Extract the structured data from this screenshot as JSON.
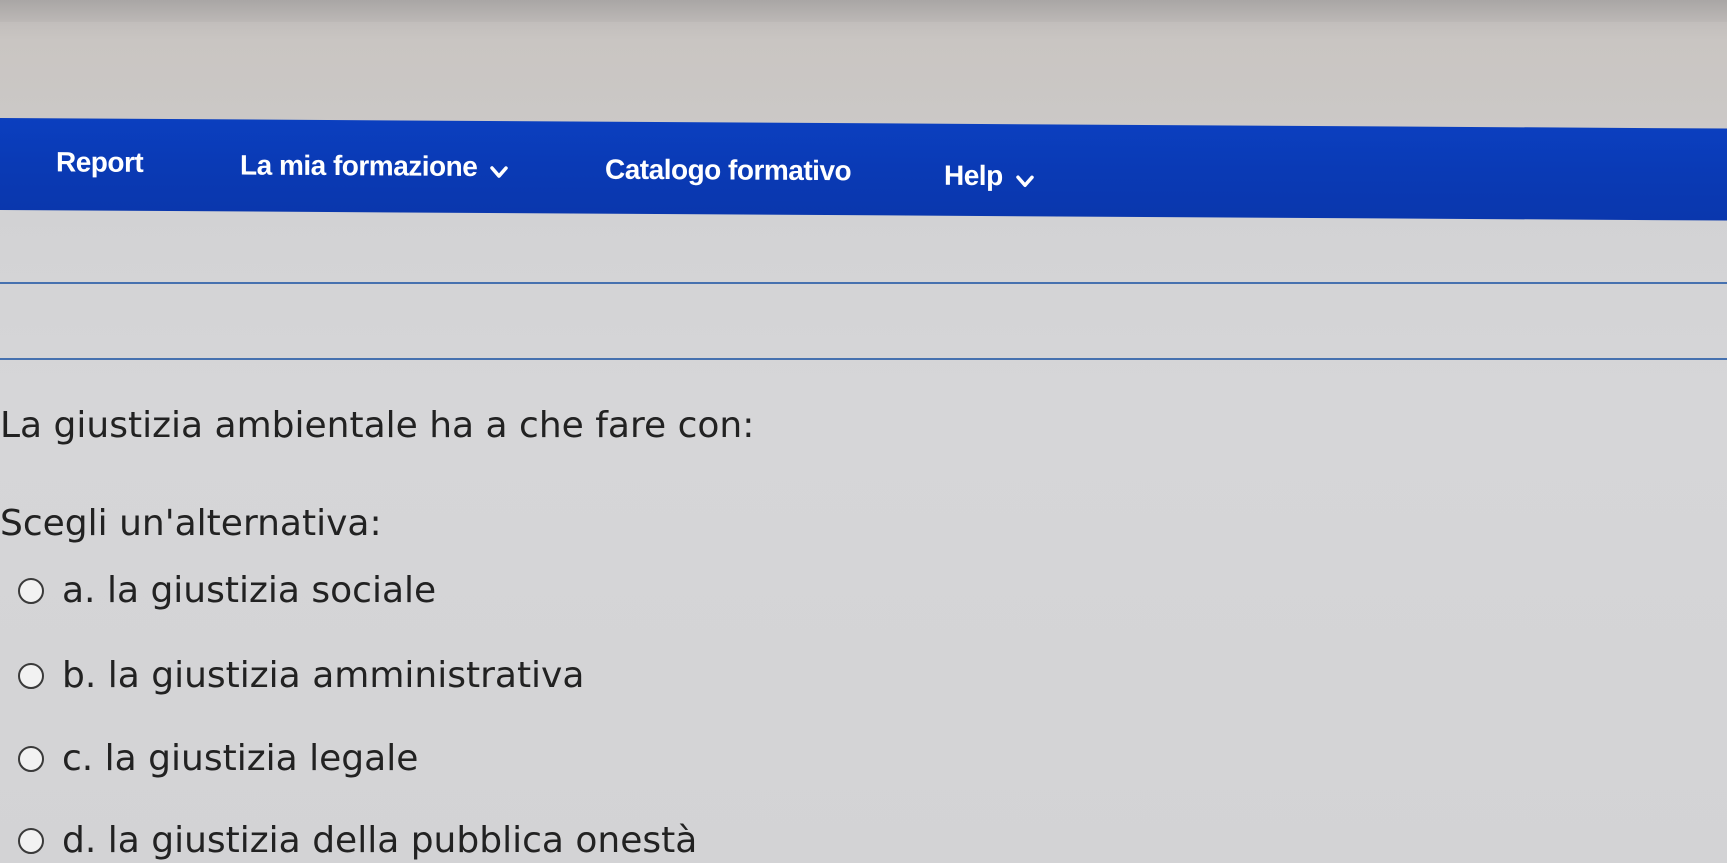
{
  "nav": {
    "items": [
      {
        "label": "Report",
        "has_dropdown": false
      },
      {
        "label": "La mia formazione",
        "has_dropdown": true,
        "icon": "chevron-down-icon"
      },
      {
        "label": "Catalogo formativo",
        "has_dropdown": false
      },
      {
        "label": "Help",
        "has_dropdown": true,
        "icon": "chevron-down-icon"
      }
    ],
    "background_color": "#0a3ab5",
    "text_color": "#ffffff"
  },
  "quiz": {
    "question": "La giustizia ambientale ha a che fare con:",
    "prompt": "Scegli un'alternativa:",
    "options": [
      {
        "label": "a. la giustizia sociale",
        "selected": false
      },
      {
        "label": "b. la giustizia amministrativa",
        "selected": false
      },
      {
        "label": "c. la giustizia legale",
        "selected": false
      },
      {
        "label": "d. la giustizia della pubblica onestà",
        "selected": false
      }
    ]
  },
  "colors": {
    "divider": "#2d5fa8",
    "page_background": "#d6d6d8"
  }
}
